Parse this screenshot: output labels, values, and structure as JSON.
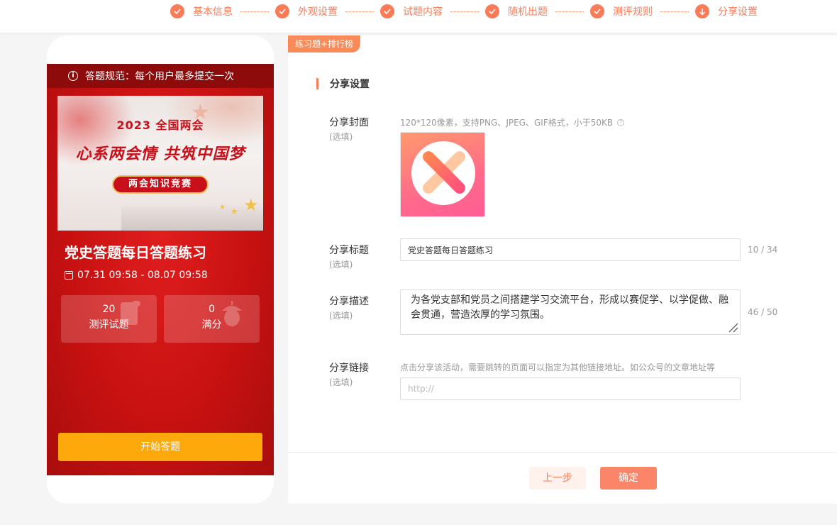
{
  "steps": [
    {
      "label": "基本信息",
      "icon": "check-icon"
    },
    {
      "label": "外观设置",
      "icon": "check-icon"
    },
    {
      "label": "试题内容",
      "icon": "check-icon"
    },
    {
      "label": "随机出题",
      "icon": "check-icon"
    },
    {
      "label": "测评规则",
      "icon": "check-icon"
    },
    {
      "label": "分享设置",
      "icon": "arrow-down-icon"
    }
  ],
  "colors": {
    "accent": "#fa7b57",
    "phone_red": "#c81111",
    "start_button": "#fda80b"
  },
  "phone": {
    "notice": "答题规范：每个用户最多提交一次",
    "banner": {
      "year": "2023 全国两会",
      "title": "心系两会情 共筑中国梦",
      "badge": "两会知识竞赛"
    },
    "title": "党史答题每日答题练习",
    "date": "07.31 09:58 - 08.07 09:58",
    "stats": [
      {
        "value": "20",
        "label": "测评试题"
      },
      {
        "value": "0",
        "label": "满分"
      }
    ],
    "start_button": "开始答题"
  },
  "panel": {
    "tag": "练习题+排行榜",
    "section_title": "分享设置",
    "cover": {
      "label": "分享封面",
      "optional": "(选填)",
      "hint": "120*120像素，支持PNG、JPEG、GIF格式，小于50KB"
    },
    "share_title": {
      "label": "分享标题",
      "optional": "(选填)",
      "value": "党史答题每日答题练习",
      "counter": "10 / 34"
    },
    "share_desc": {
      "label": "分享描述",
      "optional": "(选填)",
      "value": "为各党支部和党员之间搭建学习交流平台，形成以赛促学、以学促做、融会贯通，营造浓厚的学习氛围。",
      "counter": "46 / 50"
    },
    "share_link": {
      "label": "分享链接",
      "optional": "(选填)",
      "hint": "点击分享该活动，需要跳转的页面可以指定为其他链接地址。如公众号的文章地址等",
      "placeholder": "http://"
    },
    "prev_button": "上一步",
    "confirm_button": "确定"
  }
}
